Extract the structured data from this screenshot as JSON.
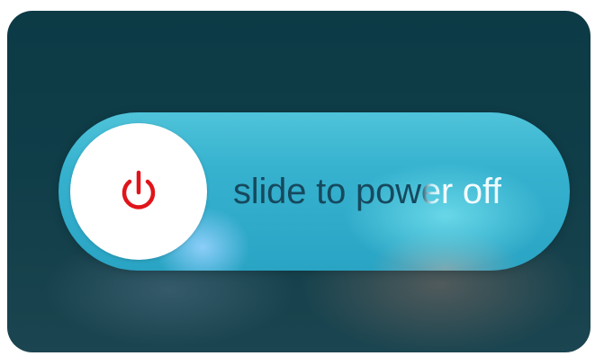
{
  "power_off_slider": {
    "label": "slide to power off",
    "icon": "power-icon",
    "icon_color": "#e0141a"
  }
}
